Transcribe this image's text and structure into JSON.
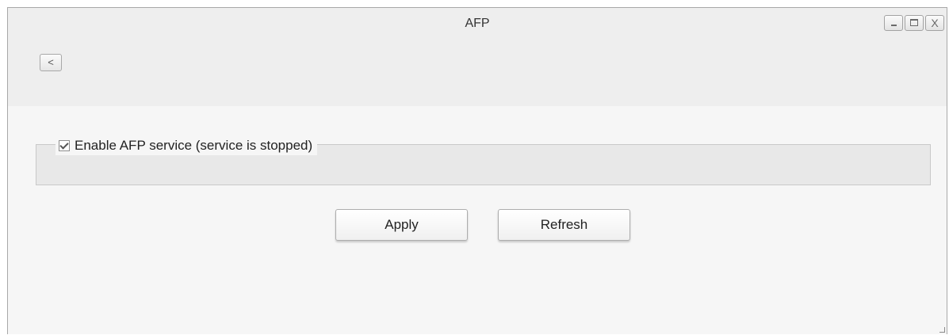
{
  "window": {
    "title": "AFP",
    "controls": {
      "minimize_icon": "minimize-icon",
      "maximize_icon": "maximize-icon",
      "close_icon": "close-icon",
      "close_glyph": "X"
    }
  },
  "nav": {
    "back_label": "<"
  },
  "afp": {
    "enable_label": "Enable AFP service (service is stopped)",
    "enable_checked": true
  },
  "actions": {
    "apply_label": "Apply",
    "refresh_label": "Refresh"
  },
  "colors": {
    "window_bg": "#efefef",
    "content_bg": "#f6f6f6",
    "fieldset_bg": "#e8e8e8",
    "border": "#a8a8a8"
  }
}
